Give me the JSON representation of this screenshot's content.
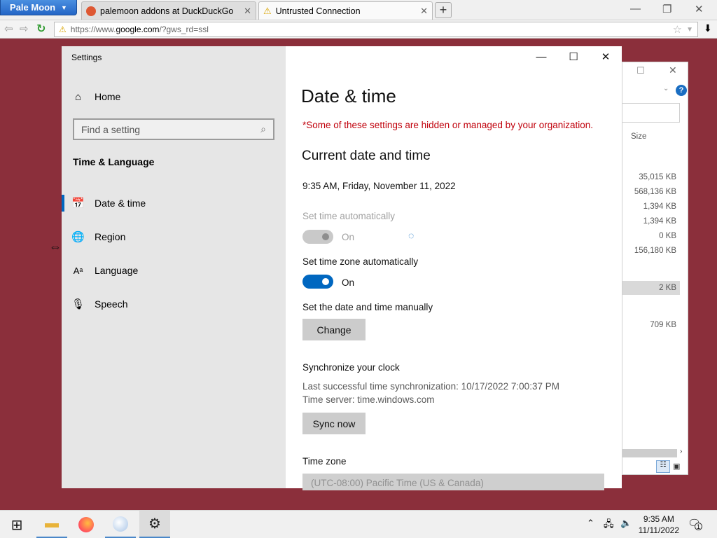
{
  "browser": {
    "app_button": "Pale Moon",
    "tabs": [
      {
        "title": "palemoon addons at DuckDuckGo"
      },
      {
        "title": "Untrusted Connection"
      }
    ],
    "new_tab": "+",
    "url_prefix": "https://www.",
    "url_domain": "google.com",
    "url_suffix": "/?gws_rd=ssl"
  },
  "explorer": {
    "column_size": "Size",
    "sizes": [
      "35,015 KB",
      "568,136 KB",
      "1,394 KB",
      "1,394 KB",
      "0 KB",
      "156,180 KB",
      "2 KB",
      "709 KB"
    ]
  },
  "settings": {
    "window_title": "Settings",
    "nav": {
      "home": "Home",
      "search_placeholder": "Find a setting",
      "section": "Time & Language",
      "items": [
        {
          "label": "Date & time"
        },
        {
          "label": "Region"
        },
        {
          "label": "Language"
        },
        {
          "label": "Speech"
        }
      ]
    },
    "page_title": "Date & time",
    "managed_warning": "*Some of these settings are hidden or managed by your organization.",
    "current_heading": "Current date and time",
    "current_value": "9:35 AM, Friday, November 11, 2022",
    "set_time_auto_label": "Set time automatically",
    "set_time_auto_state": "On",
    "set_tz_auto_label": "Set time zone automatically",
    "set_tz_auto_state": "On",
    "manual_label": "Set the date and time manually",
    "change_button": "Change",
    "sync_heading": "Synchronize your clock",
    "last_sync": "Last successful time synchronization: 10/17/2022 7:00:37 PM",
    "time_server": "Time server: time.windows.com",
    "sync_button": "Sync now",
    "timezone_label": "Time zone",
    "timezone_value": "(UTC-08:00) Pacific Time (US & Canada)"
  },
  "taskbar": {
    "time": "9:35 AM",
    "date": "11/11/2022",
    "notification_count": "1"
  },
  "colors": {
    "accent": "#0067c0",
    "warning": "#c0000b",
    "desktop": "#8b2f3b"
  }
}
